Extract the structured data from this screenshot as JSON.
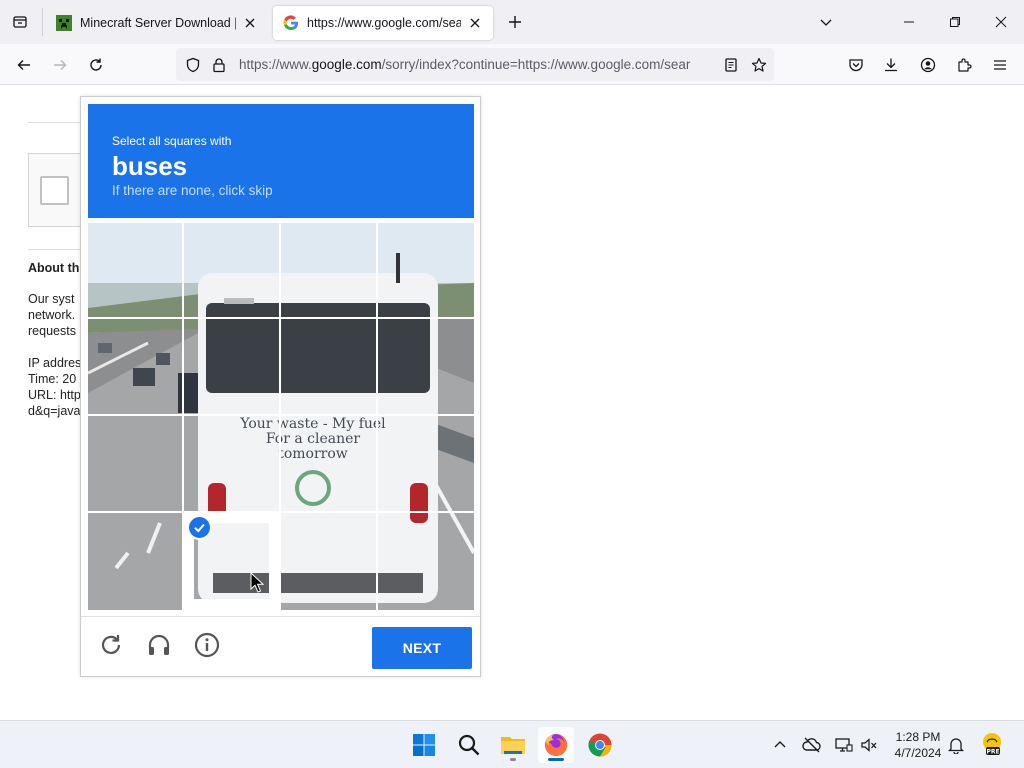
{
  "browser": {
    "tabs": [
      {
        "title": "Minecraft Server Download | Mi",
        "active": false
      },
      {
        "title": "https://www.google.com/searc",
        "active": true
      }
    ],
    "url_prefix": "https://www.",
    "url_domain": "google.com",
    "url_rest": "/sorry/index?continue=https://www.google.com/sear"
  },
  "background_page": {
    "heading": "About th",
    "lines": [
      "Our syst",
      "network.",
      "requests",
      "IP addres",
      "Time: 20",
      "URL: http",
      "d&q=java"
    ]
  },
  "captcha": {
    "instruction": "Select all squares with",
    "target": "buses",
    "hint": "If there are none, click skip",
    "next_label": "NEXT",
    "bus_text_line1": "Your waste - My fuel",
    "bus_text_line2": "For a cleaner",
    "bus_text_line3": "tomorrow",
    "selected_tiles": [
      13
    ],
    "accent_color": "#1a73e8"
  },
  "taskbar": {
    "time": "1:28 PM",
    "date": "4/7/2024",
    "pre_badge": "PRE"
  }
}
